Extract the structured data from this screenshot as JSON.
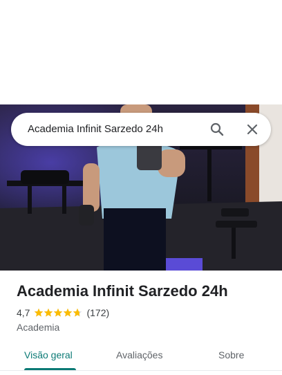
{
  "search": {
    "query": "Academia Infinit Sarzedo 24h"
  },
  "icons": {
    "search": "search-icon",
    "close": "close-icon",
    "star": "star-icon"
  },
  "place": {
    "name": "Academia Infinit Sarzedo 24h",
    "rating": "4,7",
    "rating_value": 4.7,
    "review_count": "(172)",
    "category": "Academia"
  },
  "tabs": [
    {
      "label": "Visão geral",
      "active": true
    },
    {
      "label": "Avaliações",
      "active": false
    },
    {
      "label": "Sobre",
      "active": false
    }
  ],
  "colors": {
    "accent": "#0b7a75",
    "star": "#fbbc04",
    "text": "#202124",
    "secondary_text": "#5f6368"
  }
}
